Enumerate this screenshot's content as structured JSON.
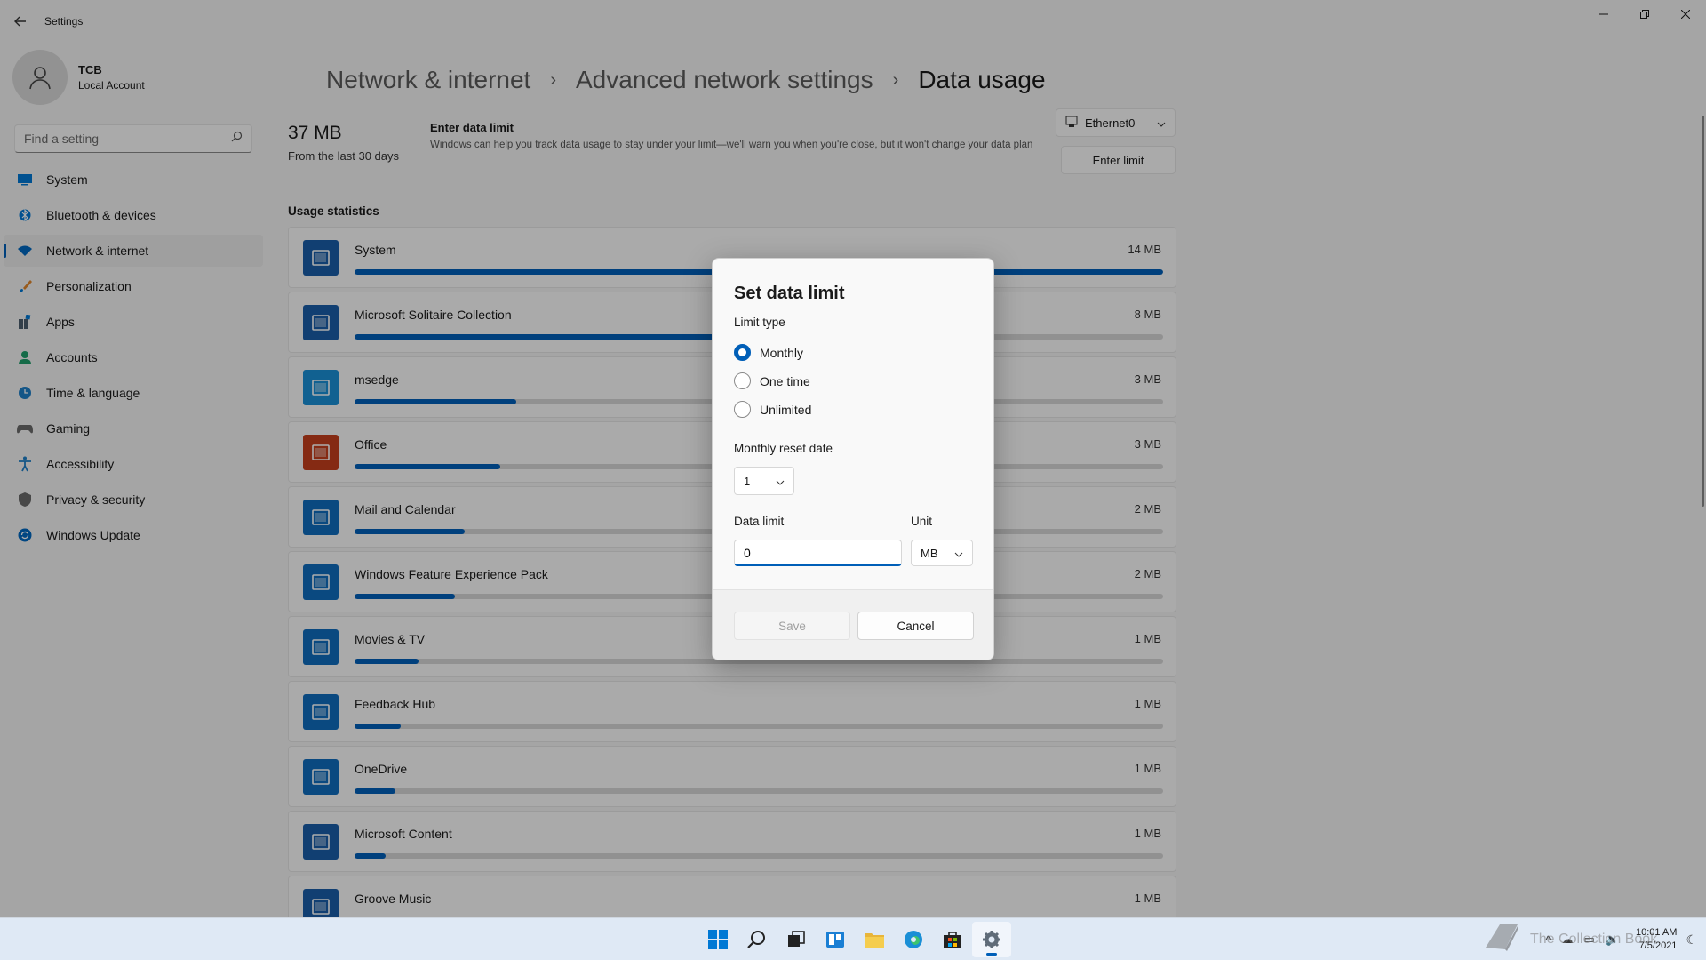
{
  "window": {
    "title": "Settings",
    "back_icon": "back-arrow-icon"
  },
  "profile": {
    "name": "TCB",
    "account_type": "Local Account"
  },
  "search": {
    "placeholder": "Find a setting"
  },
  "sidebar": {
    "items": [
      {
        "label": "System",
        "icon": "system-icon",
        "color": "#0078d4"
      },
      {
        "label": "Bluetooth & devices",
        "icon": "bluetooth-icon",
        "color": "#0078d4"
      },
      {
        "label": "Network & internet",
        "icon": "wifi-icon",
        "color": "#0067c0",
        "active": true
      },
      {
        "label": "Personalization",
        "icon": "brush-icon",
        "color": "#e0872c"
      },
      {
        "label": "Apps",
        "icon": "apps-icon",
        "color": "#4c5d6e"
      },
      {
        "label": "Accounts",
        "icon": "accounts-icon",
        "color": "#1f9e6a"
      },
      {
        "label": "Time & language",
        "icon": "globe-clock-icon",
        "color": "#1e7fc8"
      },
      {
        "label": "Gaming",
        "icon": "gamepad-icon",
        "color": "#6b6b6b"
      },
      {
        "label": "Accessibility",
        "icon": "accessibility-icon",
        "color": "#1e7fc8"
      },
      {
        "label": "Privacy & security",
        "icon": "shield-icon",
        "color": "#6b6b6b"
      },
      {
        "label": "Windows Update",
        "icon": "update-icon",
        "color": "#0067c0"
      }
    ]
  },
  "breadcrumb": {
    "level1": "Network & internet",
    "level2": "Advanced network settings",
    "current": "Data usage",
    "separator": "›"
  },
  "summary": {
    "value": "37 MB",
    "period": "From the last 30 days"
  },
  "data_limit": {
    "title": "Enter data limit",
    "description": "Windows can help you track data usage to stay under your limit—we'll warn you when you're close, but it won't change your data plan",
    "button": "Enter limit"
  },
  "adapter": {
    "selected": "Ethernet0"
  },
  "usage": {
    "title": "Usage statistics",
    "apps": [
      {
        "name": "System",
        "size": "14 MB",
        "fraction": 1.0,
        "icon": "system-app-icon",
        "color": "#1a5ea8"
      },
      {
        "name": "Microsoft Solitaire Collection",
        "size": "8 MB",
        "fraction": 0.57,
        "icon": "solitaire-icon",
        "color": "#1a5ea8"
      },
      {
        "name": "msedge",
        "size": "3 MB",
        "fraction": 0.2,
        "icon": "edge-icon",
        "color": "#1a8fd6"
      },
      {
        "name": "Office",
        "size": "3 MB",
        "fraction": 0.18,
        "icon": "office-icon",
        "color": "#c43e1c"
      },
      {
        "name": "Mail and Calendar",
        "size": "2 MB",
        "fraction": 0.136,
        "icon": "mail-icon",
        "color": "#0f6cbd"
      },
      {
        "name": "Windows Feature Experience Pack",
        "size": "2 MB",
        "fraction": 0.124,
        "icon": "feature-pack-icon",
        "color": "#0f6cbd"
      },
      {
        "name": "Movies & TV",
        "size": "1 MB",
        "fraction": 0.079,
        "icon": "movies-icon",
        "color": "#0f6cbd"
      },
      {
        "name": "Feedback Hub",
        "size": "1 MB",
        "fraction": 0.057,
        "icon": "feedback-icon",
        "color": "#0f6cbd"
      },
      {
        "name": "OneDrive",
        "size": "1 MB",
        "fraction": 0.051,
        "icon": "onedrive-icon",
        "color": "#0f6cbd"
      },
      {
        "name": "Microsoft Content",
        "size": "1 MB",
        "fraction": 0.039,
        "icon": "microsoft-content-icon",
        "color": "#1a5ea8"
      },
      {
        "name": "Groove Music",
        "size": "1 MB",
        "fraction": 0.03,
        "icon": "groove-icon",
        "color": "#1a5ea8"
      }
    ]
  },
  "dialog": {
    "title": "Set data limit",
    "limit_type_label": "Limit type",
    "options": [
      {
        "label": "Monthly",
        "selected": true
      },
      {
        "label": "One time",
        "selected": false
      },
      {
        "label": "Unlimited",
        "selected": false
      }
    ],
    "reset_date_label": "Monthly reset date",
    "reset_date_value": "1",
    "data_limit_label": "Data limit",
    "data_limit_value": "0",
    "unit_label": "Unit",
    "unit_value": "MB",
    "save_label": "Save",
    "cancel_label": "Cancel",
    "save_disabled": true
  },
  "taskbar": {
    "apps": [
      "start-icon",
      "search-icon",
      "task-view-icon",
      "widgets-icon",
      "file-explorer-icon",
      "edge-icon",
      "store-icon",
      "settings-icon"
    ],
    "active_app": "settings-icon",
    "time": "10:01 AM",
    "date": "7/5/2021"
  },
  "watermark": {
    "text": "The Collection Book"
  },
  "colors": {
    "accent": "#005fb8",
    "overlay": "rgba(0,0,0,0.32)"
  }
}
